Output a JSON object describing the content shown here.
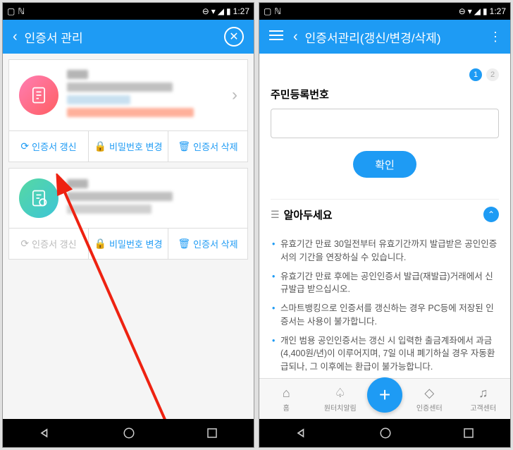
{
  "statusbar": {
    "time": "1:27",
    "icons": {
      "image": "▢",
      "nfc": "ℕ",
      "minus": "⊖",
      "wifi": "▾",
      "signal": "◢",
      "battery": "▮"
    }
  },
  "left": {
    "header_title": "인증서 관리",
    "actions": {
      "renew": "인증서 갱신",
      "change_pw": "비밀번호 변경",
      "delete": "인증서 삭제"
    }
  },
  "right": {
    "header_title": "인증서관리(갱신/변경/삭제)",
    "steps": {
      "s1": "1",
      "s2": "2"
    },
    "field_label": "주민등록번호",
    "input_placeholder": "",
    "confirm": "확인",
    "notice_title": "알아두세요",
    "notices": [
      "유효기간 만료 30일전부터 유효기간까지 발급받은 공인인증서의 기간을 연장하실 수 있습니다.",
      "유효기간 만료 후에는 공인인증서 발급(재발급)거래에서 신규발급 받으십시오.",
      "스마트뱅킹으로 인증서를 갱신하는 경우 PC등에 저장된 인증서는 사용이 불가합니다.",
      "개인 범용 공인인증서는 갱신 시 입력한 출금계좌에서 과금(4,400원/년)이 이루어지며, 7일 이내 폐기하실 경우 자동환급되나, 그 이후에는 환급이 불가능합니다."
    ],
    "tabs": {
      "home": "홈",
      "alert": "원터치알림",
      "cert": "인증센터",
      "cs": "고객센터"
    }
  }
}
